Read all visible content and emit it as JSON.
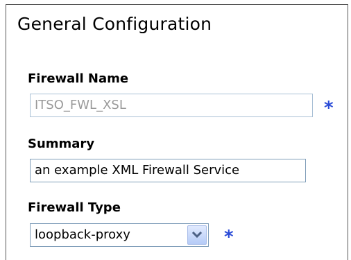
{
  "panel": {
    "title": "General Configuration"
  },
  "fields": {
    "firewall_name": {
      "label": "Firewall Name",
      "value": "ITSO_FWL_XSL",
      "required_marker": "*"
    },
    "summary": {
      "label": "Summary",
      "value": "an example XML Firewall Service"
    },
    "firewall_type": {
      "label": "Firewall Type",
      "selected": "loopback-proxy",
      "required_marker": "*"
    }
  },
  "icons": {
    "dropdown": "chevron-down-icon"
  },
  "colors": {
    "required": "#2a4bd7",
    "input_border": "#7f9db9",
    "disabled_text": "#9a9a9a"
  }
}
